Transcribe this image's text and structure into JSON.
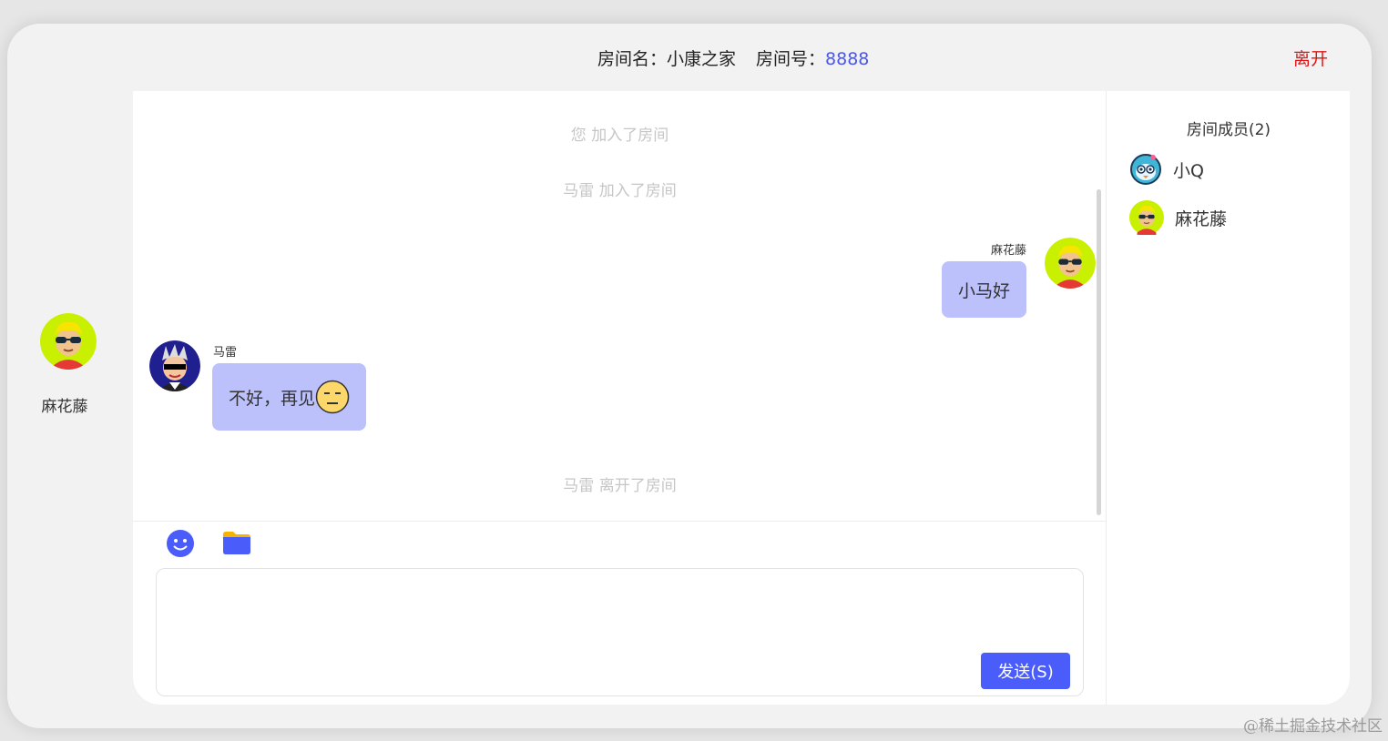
{
  "header": {
    "room_name_label": "房间名：",
    "room_name": "小康之家",
    "room_id_label": "房间号：",
    "room_id": "8888",
    "leave_label": "离开"
  },
  "self_user": {
    "name": "麻花藤",
    "avatar_icon": "glasses-boy-avatar-icon"
  },
  "messages": {
    "system": [
      "您 加入了房间",
      "马雷 加入了房间",
      "马雷 离开了房间"
    ],
    "outgoing": {
      "sender": "麻花藤",
      "text": "小马好"
    },
    "incoming": {
      "sender": "马雷",
      "text": "不好，再见"
    }
  },
  "toolbar": {
    "emoji_icon": "smiley-icon",
    "file_icon": "folder-icon"
  },
  "composer": {
    "value": "",
    "send_label": "发送(S)"
  },
  "members": {
    "title": "房间成员(2)",
    "list": [
      {
        "name": "小Q",
        "avatar_icon": "robot-bird-avatar-icon"
      },
      {
        "name": "麻花藤",
        "avatar_icon": "glasses-boy-avatar-icon"
      }
    ]
  },
  "watermark": "@稀土掘金技术社区",
  "colors": {
    "accent": "#4a5cfa",
    "bubble": "#bcc1fb",
    "leave": "#e01414",
    "room_id": "#4a57e8"
  }
}
